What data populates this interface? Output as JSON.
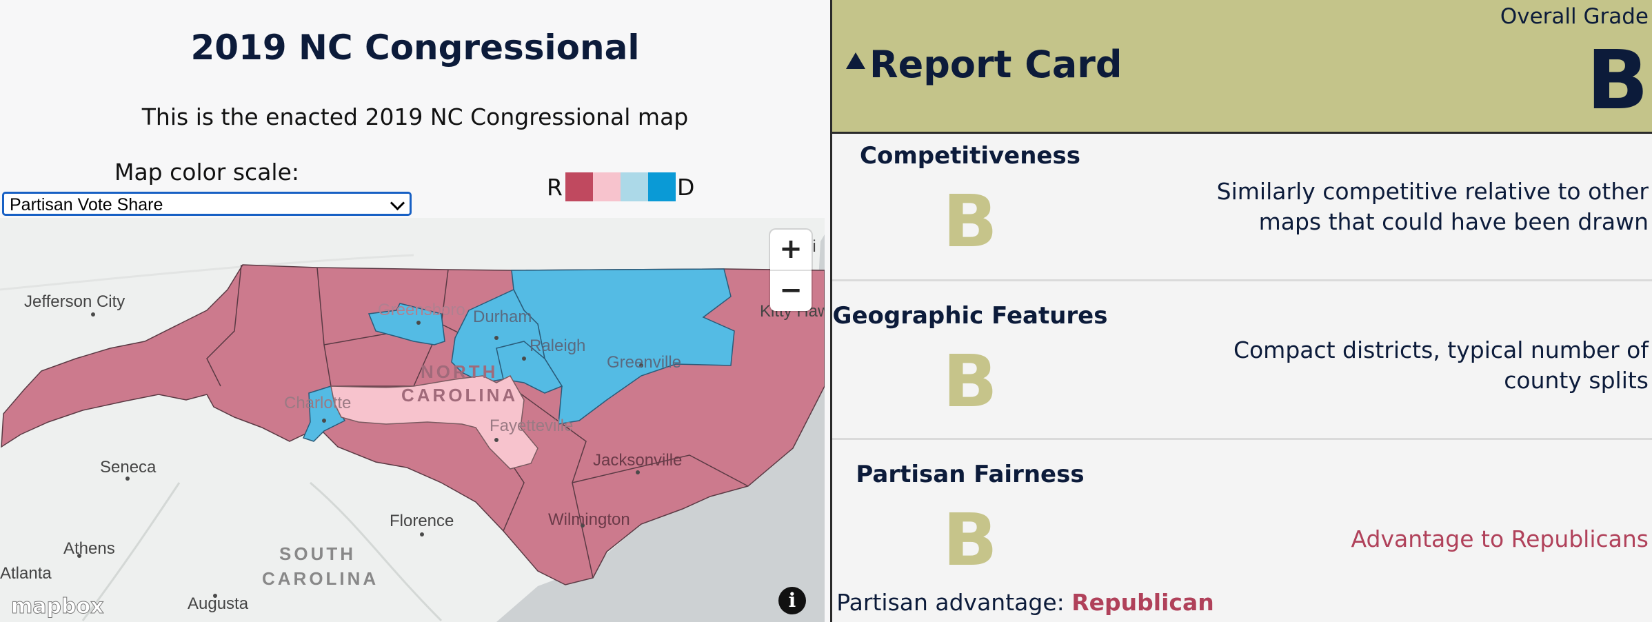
{
  "header": {
    "title": "2019 NC Congressional",
    "subtitle": "This is the enacted 2019 NC Congressional map"
  },
  "map_controls": {
    "scale_label": "Map color scale:",
    "scale_value": "Partisan Vote Share",
    "legend_left": "R",
    "legend_right": "D",
    "legend_colors": [
      "#c0495f",
      "#f7c3cd",
      "#acd9e8",
      "#0a9ad6"
    ],
    "zoom_in": "+",
    "zoom_out": "−",
    "info": "i",
    "logo": "mapbox"
  },
  "map_labels": {
    "jefferson_city": "Jefferson City",
    "greensboro": "Greensboro",
    "durham": "Durham",
    "raleigh": "Raleigh",
    "greenville": "Greenville",
    "kitty_hawk": "Kitty Haw",
    "north": "NORTH",
    "carolina": "CAROLINA",
    "charlotte": "Charlotte",
    "fayetteville": "Fayetteville",
    "jacksonville": "Jacksonville",
    "seneca": "Seneca",
    "florence": "Florence",
    "wilmington": "Wilmington",
    "athens": "Athens",
    "south": "SOUTH",
    "carolina_s": "CAROLINA",
    "atlanta": "Atlanta",
    "augusta": "Augusta",
    "ni": "ni"
  },
  "report_card": {
    "title": "Report Card",
    "overall_label": "Overall Grade",
    "overall_grade": "B",
    "sections": [
      {
        "title": "Competitiveness",
        "grade": "B",
        "description": "Similarly competitive relative to other maps that could have been drawn"
      },
      {
        "title": "Geographic Features",
        "grade": "B",
        "description": "Compact districts, typical number of county splits"
      },
      {
        "title": "Partisan Fairness",
        "grade": "B",
        "description": "Advantage to Republicans",
        "advantage_label": "Partisan advantage:",
        "advantage_value": "Republican"
      }
    ]
  }
}
